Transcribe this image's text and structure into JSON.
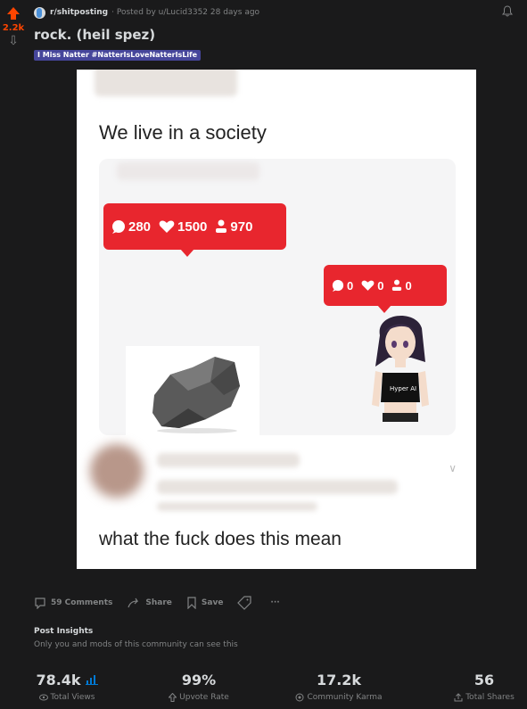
{
  "post": {
    "score": "2.2k",
    "subreddit": "r/shitposting",
    "posted_by": "· Posted by u/Lucid3352 28 days ago",
    "title": "rock. (heil spez)",
    "flair": "I Miss Natter #NatterIsLoveNatterIsLife"
  },
  "meme": {
    "top_text": "We live in a society",
    "bottom_text": "what the fuck does this mean",
    "left_notification": {
      "comments": "280",
      "likes": "1500",
      "followers": "970"
    },
    "right_notification": {
      "comments": "0",
      "likes": "0",
      "followers": "0"
    },
    "shirt_text": "Hyper AI"
  },
  "actions": {
    "comments": "59 Comments",
    "share": "Share",
    "save": "Save",
    "more": "···"
  },
  "insights": {
    "title": "Post Insights",
    "subtitle": "Only you and mods of this community can see this"
  },
  "stats": [
    {
      "value": "78.4k",
      "label": "Total Views"
    },
    {
      "value": "99%",
      "label": "Upvote Rate"
    },
    {
      "value": "17.2k",
      "label": "Community Karma"
    },
    {
      "value": "56",
      "label": "Total Shares"
    }
  ],
  "colors": {
    "upvote": "#ff4500",
    "flair": "#46469b",
    "notification": "#e8262e",
    "stats_icon": "#0079d3"
  }
}
